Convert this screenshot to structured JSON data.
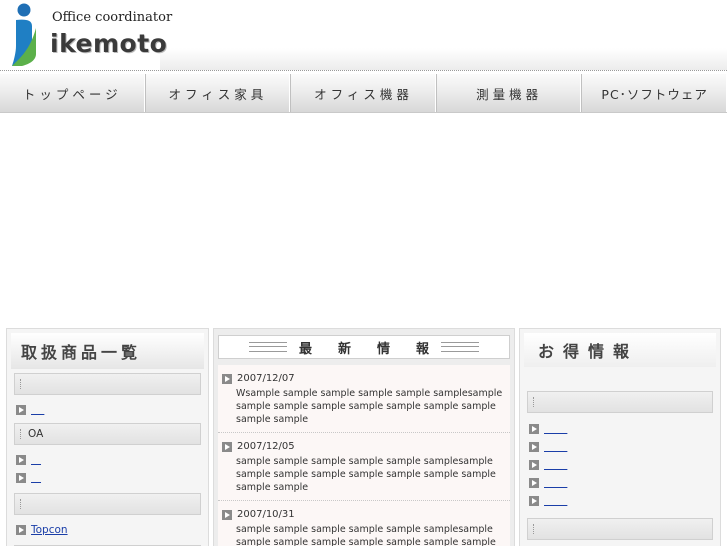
{
  "header": {
    "tagline": "Office coordinator",
    "brand": "ikemoto"
  },
  "nav": {
    "items": [
      "トップページ",
      "オフィス家具",
      "オフィス機器",
      "測量機器",
      "PC･ソフトウェア"
    ]
  },
  "left": {
    "title": "取扱商品一覧",
    "category_2_label": "OA",
    "topcon_link": "Topcon"
  },
  "news": {
    "title": "最新情報",
    "items": [
      {
        "date": "2007/12/07",
        "text": "Wsample sample sample sample sample samplesample sample sample sample sample sample sample sample sample sample"
      },
      {
        "date": "2007/12/05",
        "text": "sample sample sample sample sample samplesample sample sample sample sample sample sample sample sample sample"
      },
      {
        "date": "2007/10/31",
        "text": "sample sample sample sample sample samplesample sample sample sample sample sample sample sample sample sample"
      }
    ]
  },
  "right": {
    "title": "お得情報"
  },
  "colors": {
    "link": "#1a3ea8",
    "logo_blue": "#1f7fc4",
    "logo_green": "#5bb04a"
  }
}
